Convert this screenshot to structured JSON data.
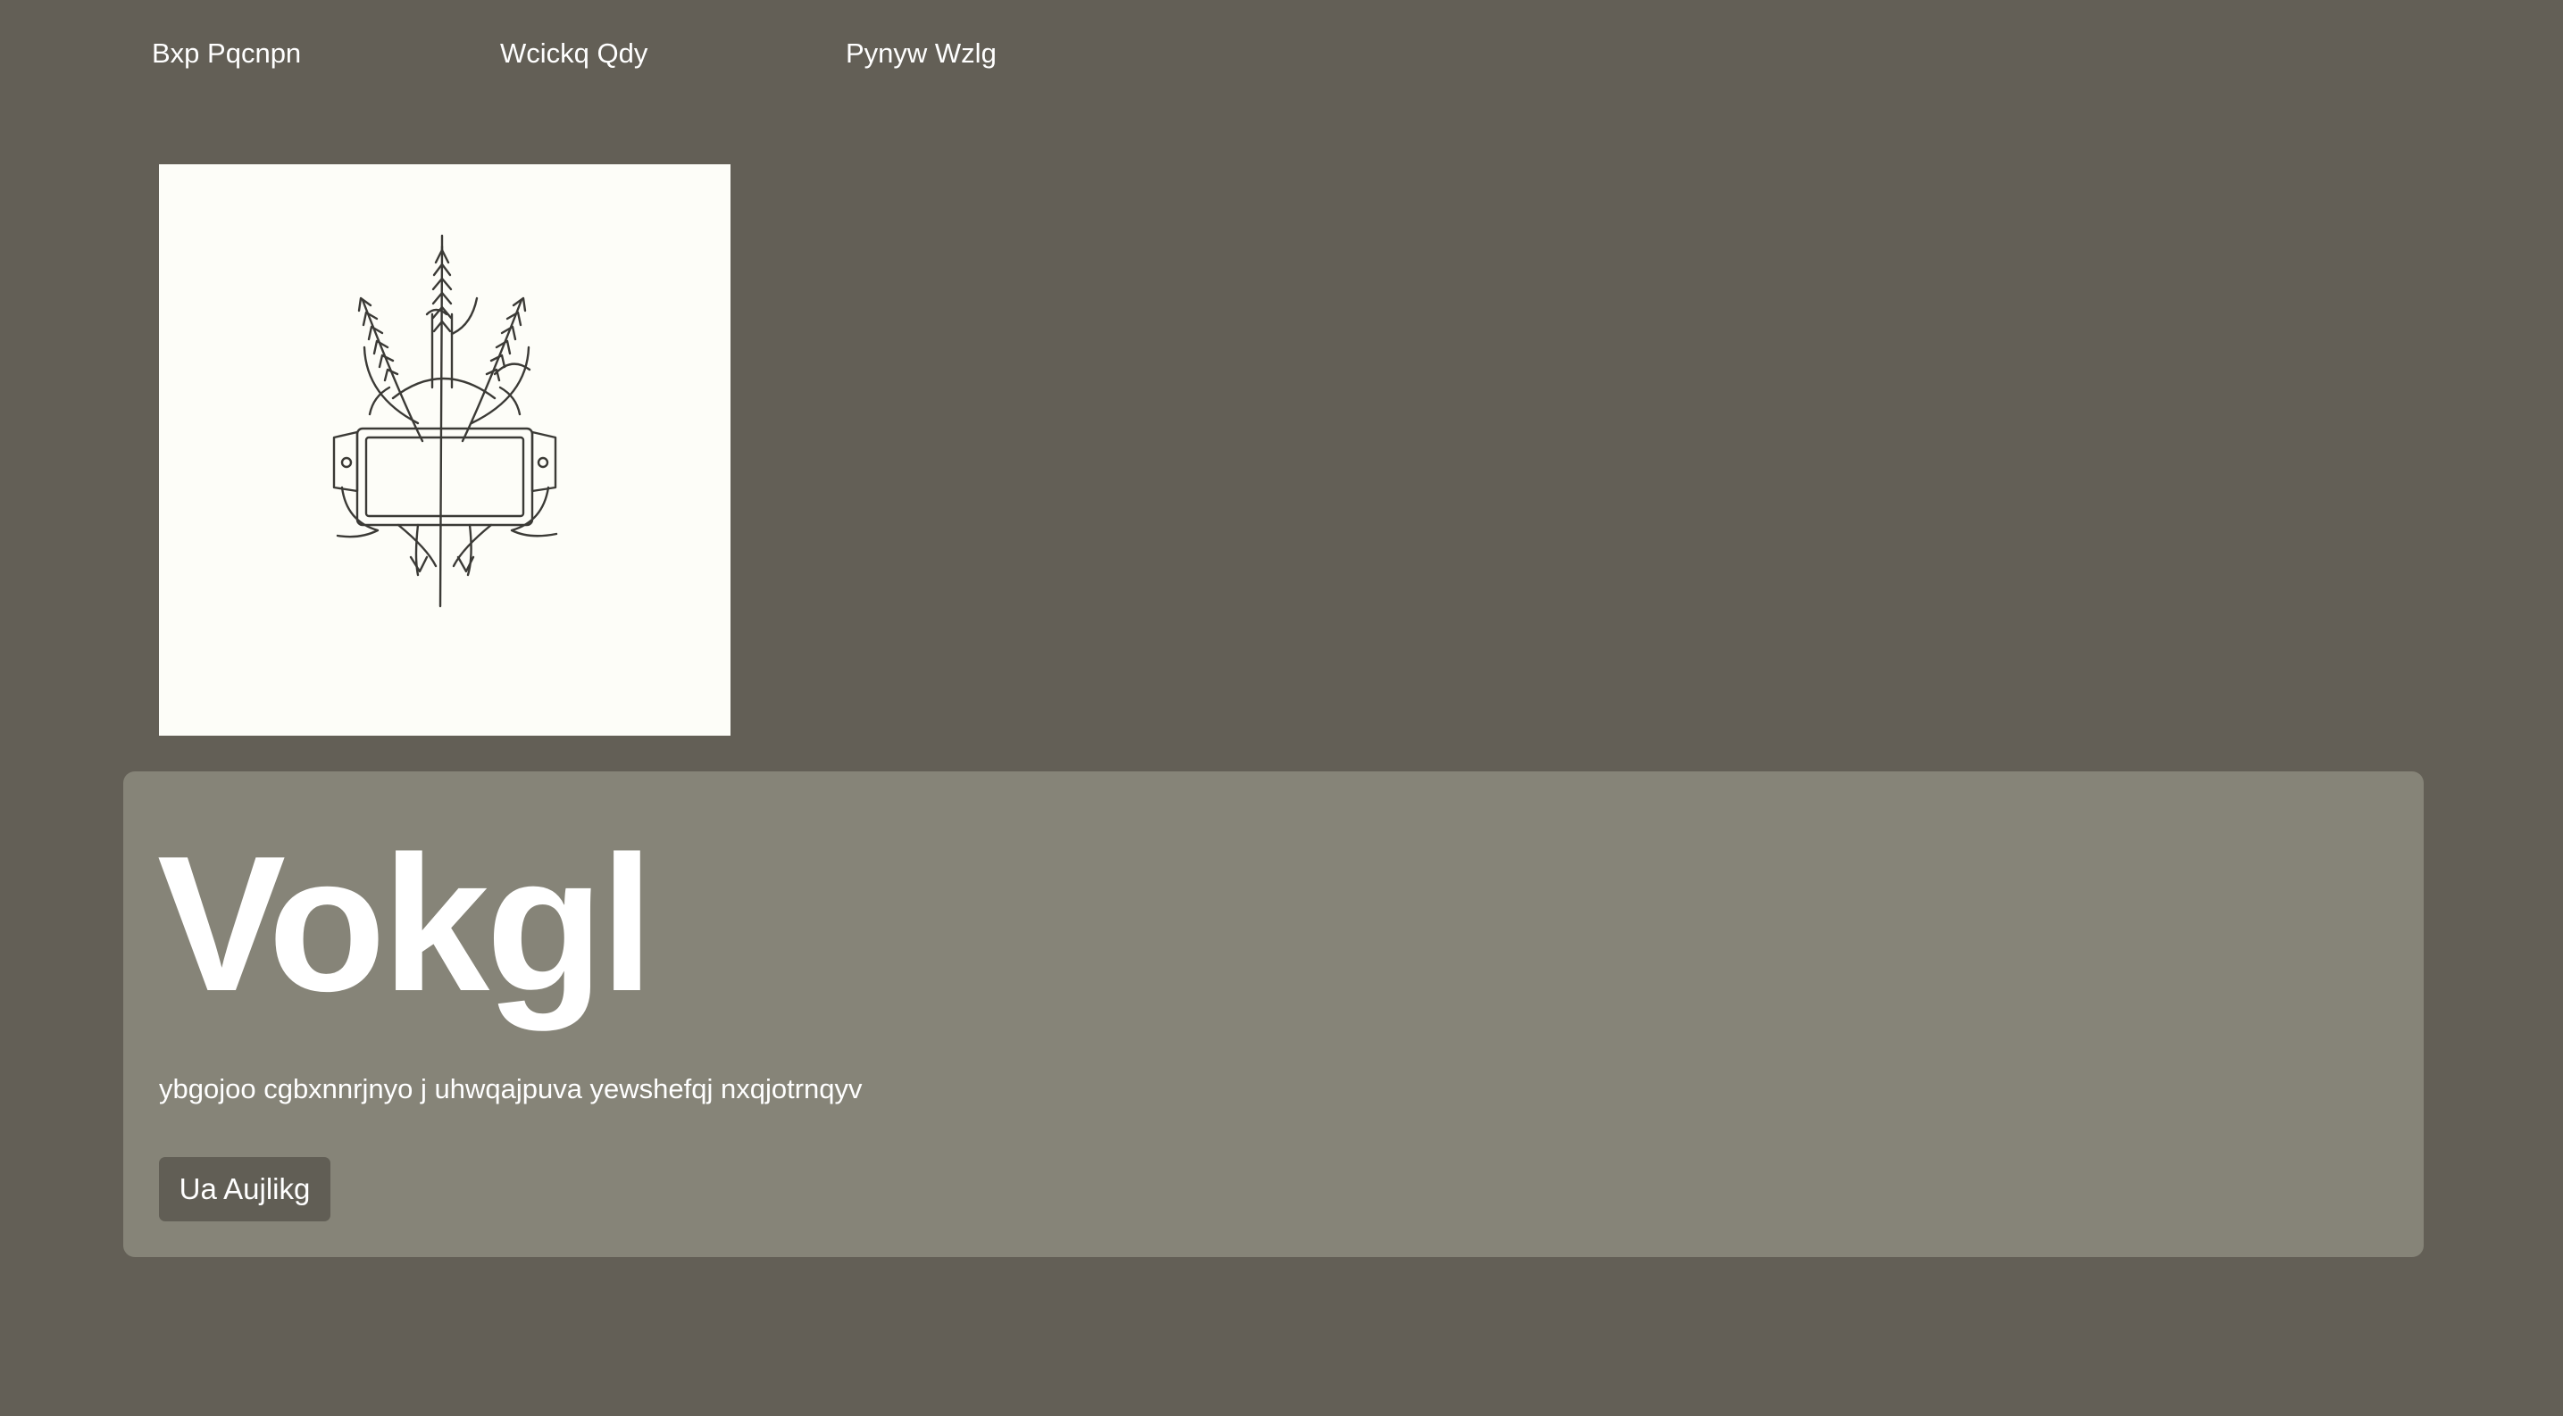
{
  "nav": {
    "links": [
      {
        "label": "Bxp Pqcnpn"
      },
      {
        "label": "Wcickq Qdy"
      },
      {
        "label": "Pynyw Wzlg"
      }
    ]
  },
  "logo": {
    "icon": "wheat-crest-icon"
  },
  "hero": {
    "title": "Vokgl",
    "subtitle": "ybgojoo cgbxnnrjnyo j uhwqajpuva yewshefqj nxqjotrnqyv",
    "button_label": "Ua Aujlikg"
  },
  "colors": {
    "page_background": "#635f56",
    "hero_background": "#868478",
    "button_background": "#615e55",
    "logo_background": "#fdfdf8",
    "text": "#ffffff"
  }
}
